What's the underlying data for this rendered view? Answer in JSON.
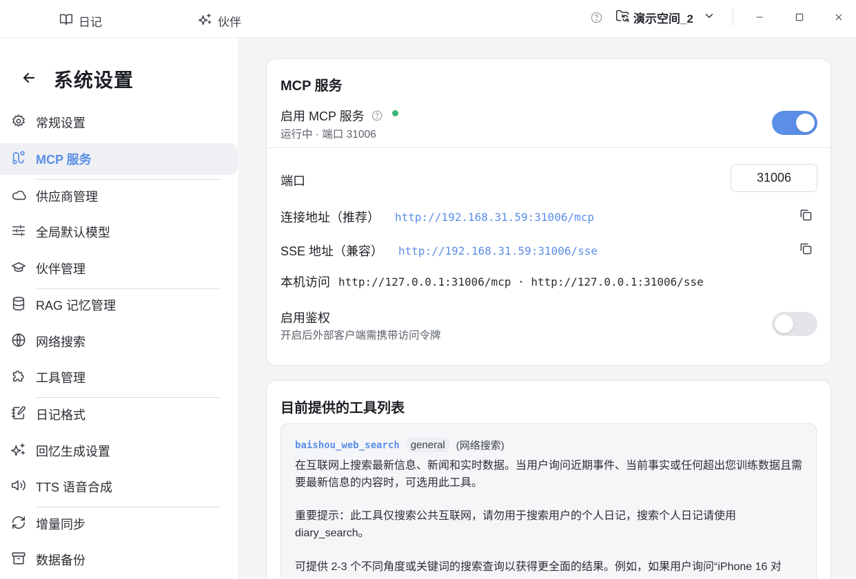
{
  "topbar": {
    "nav": [
      {
        "label": "日记",
        "icon": "book-icon"
      },
      {
        "label": "伙伴",
        "icon": "sparkles-icon"
      }
    ],
    "workspace": "演示空间_2"
  },
  "sidebar": {
    "title": "系统设置",
    "items": [
      {
        "label": "常规设置",
        "icon": "gear-icon"
      },
      {
        "label": "MCP 服务",
        "icon": "route-icon"
      },
      {
        "label": "供应商管理",
        "icon": "cloud-icon"
      },
      {
        "label": "全局默认模型",
        "icon": "sliders-icon"
      },
      {
        "label": "伙伴管理",
        "icon": "graduation-cap-icon"
      },
      {
        "label": "RAG 记忆管理",
        "icon": "database-icon"
      },
      {
        "label": "网络搜索",
        "icon": "globe-icon"
      },
      {
        "label": "工具管理",
        "icon": "puzzle-icon"
      },
      {
        "label": "日记格式",
        "icon": "notebook-pen-icon"
      },
      {
        "label": "回忆生成设置",
        "icon": "sparkles-icon"
      },
      {
        "label": "TTS 语音合成",
        "icon": "speaker-icon"
      },
      {
        "label": "增量同步",
        "icon": "refresh-icon"
      },
      {
        "label": "数据备份",
        "icon": "archive-icon"
      }
    ]
  },
  "mcp": {
    "title": "MCP 服务",
    "enable_label": "启用 MCP 服务",
    "status": "运行中 · 端口 31006",
    "enabled": true,
    "port_label": "端口",
    "port_value": "31006",
    "conn_label": "连接地址（推荐）",
    "conn_url": "http://192.168.31.59:31006/mcp",
    "sse_label": "SSE 地址（兼容）",
    "sse_url": "http://192.168.31.59:31006/sse",
    "local_label": "本机访问",
    "local_urls": "http://127.0.0.1:31006/mcp · http://127.0.0.1:31006/sse",
    "auth_label": "启用鉴权",
    "auth_desc": "开启后外部客户端需携带访问令牌",
    "auth_enabled": false,
    "colors": {
      "accent": "#5b8ee6",
      "status_dot": "#3cb878"
    }
  },
  "tools": {
    "title": "目前提供的工具列表",
    "tool": {
      "name": "baishou_web_search",
      "tag": "general",
      "category": "(网络搜索)",
      "para1": "在互联网上搜索最新信息、新闻和实时数据。当用户询问近期事件、当前事实或任何超出您训练数据且需要最新信息的内容时，可选用此工具。",
      "para2": "重要提示：此工具仅搜索公共互联网，请勿用于搜索用户的个人日记，搜索个人日记请使用 diary_search。",
      "para3": "可提供 2-3 个不同角度或关键词的搜索查询以获得更全面的结果。例如，如果用户询问“iPhone 16 对"
    }
  }
}
